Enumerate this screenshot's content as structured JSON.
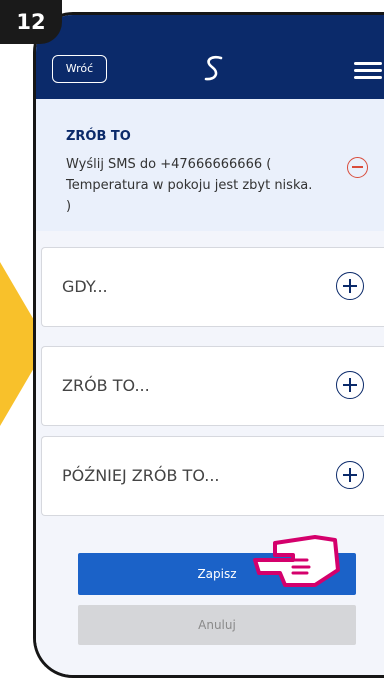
{
  "step_badge": "12",
  "topbar": {
    "back_label": "Wróć",
    "logo_icon": "s-logo-icon",
    "menu_icon": "hamburger-menu-icon"
  },
  "action": {
    "title": "ZRÓB TO",
    "text": "Wyślij SMS do +47666666666 ( Temperatura w pokoju jest zbyt niska. )",
    "remove_icon": "minus-circle-icon"
  },
  "sections": [
    {
      "label": "GDY...",
      "icon": "plus-circle-icon"
    },
    {
      "label": "ZRÓB TO...",
      "icon": "plus-circle-icon"
    },
    {
      "label": "PÓŹNIEJ ZRÓB TO...",
      "icon": "plus-circle-icon"
    }
  ],
  "buttons": {
    "save": "Zapisz",
    "cancel": "Anuluj"
  },
  "colors": {
    "header": "#0b2a6a",
    "primary": "#1b62c8",
    "danger": "#d94c3b",
    "pointer": "#d4006c",
    "arrow": "#f8c12b"
  }
}
